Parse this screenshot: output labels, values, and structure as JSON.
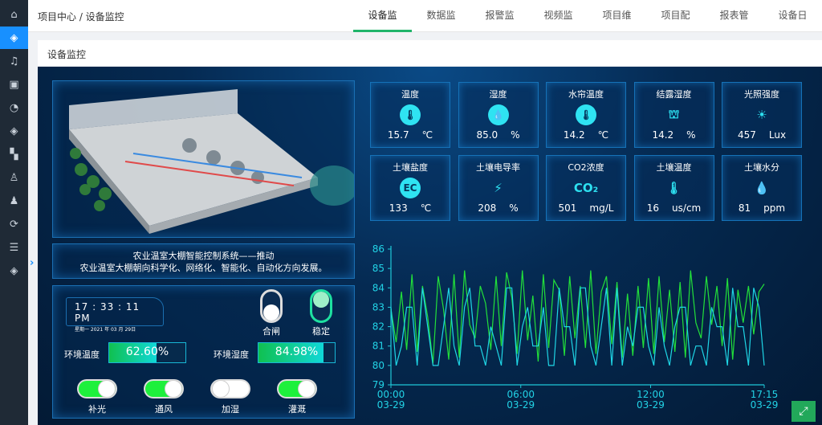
{
  "sidebar": {
    "items": [
      "home-icon",
      "layers-icon",
      "bell-icon",
      "cube-icon",
      "dashboard-icon",
      "layers-icon",
      "puzzle-icon",
      "user-icon",
      "group-icon",
      "refresh-icon",
      "list-icon",
      "layers-icon"
    ],
    "active": 1
  },
  "breadcrumb": "项目中心 / 设备监控",
  "tabs": [
    {
      "label": "设备监控",
      "active": true
    },
    {
      "label": "数据监控"
    },
    {
      "label": "报警监控"
    },
    {
      "label": "视频监控"
    },
    {
      "label": "项目维保"
    },
    {
      "label": "项目配置"
    },
    {
      "label": "报表管理"
    },
    {
      "label": "设备日志"
    }
  ],
  "panel_title": "设备监控",
  "slogan": {
    "line1": "农业温室大棚智能控制系统——推动",
    "line2": "农业温室大棚朝向科学化、网络化、智能化、自动化方向发展。"
  },
  "sensors": [
    {
      "label": "温度",
      "value": "15.7",
      "unit": "℃",
      "icon": "thermometer-icon",
      "glyph": "🌡"
    },
    {
      "label": "湿度",
      "value": "85.0",
      "unit": "%",
      "icon": "droplet-icon",
      "glyph": "💧"
    },
    {
      "label": "水帘温度",
      "value": "14.2",
      "unit": "℃",
      "icon": "thermometer-icon",
      "glyph": "🌡"
    },
    {
      "label": "结露湿度",
      "value": "14.2",
      "unit": "%",
      "icon": "dew-icon",
      "glyph": "⛫"
    },
    {
      "label": "光照强度",
      "value": "457",
      "unit": "Lux",
      "icon": "sun-icon",
      "glyph": "☀"
    },
    {
      "label": "土壤盐度",
      "value": "133",
      "unit": "℃",
      "icon": "ec-icon",
      "glyph": "EC"
    },
    {
      "label": "土壤电导率",
      "value": "208",
      "unit": "%",
      "icon": "conductivity-icon",
      "glyph": "⚡"
    },
    {
      "label": "CO2浓度",
      "value": "501",
      "unit": "mg/L",
      "icon": "co2-icon",
      "glyph": "CO₂"
    },
    {
      "label": "土壤温度",
      "value": "16",
      "unit": "us/cm",
      "icon": "soil-temp-icon",
      "glyph": "🌡"
    },
    {
      "label": "土壤水分",
      "value": "81",
      "unit": "ppm",
      "icon": "water-drops-icon",
      "glyph": "💧"
    }
  ],
  "clock": {
    "time": "17 : 33 : 11  PM",
    "date": "星期一    2021 年 03 月 29日"
  },
  "status": [
    {
      "label": "合闸",
      "state": "off"
    },
    {
      "label": "稳定",
      "state": "on"
    }
  ],
  "env": [
    {
      "label": "环境温度",
      "value": "62.60%",
      "percent": 62.6
    },
    {
      "label": "环境湿度",
      "value": "84.98%",
      "percent": 84.98
    }
  ],
  "toggles": [
    {
      "label": "补光",
      "on": true
    },
    {
      "label": "通风",
      "on": true
    },
    {
      "label": "加湿",
      "on": false
    },
    {
      "label": "灌溉",
      "on": true
    }
  ],
  "chart_data": {
    "type": "line",
    "ylim": [
      79,
      86
    ],
    "yticks": [
      "79",
      "80",
      "81",
      "82",
      "83",
      "84",
      "85",
      "86"
    ],
    "xticks": [
      {
        "time": "00:00",
        "date": "03-29",
        "min": 0
      },
      {
        "time": "06:00",
        "date": "03-29",
        "min": 360
      },
      {
        "time": "12:00",
        "date": "03-29",
        "min": 720
      },
      {
        "time": "17:15",
        "date": "03-29",
        "min": 1035
      }
    ],
    "x_range_minutes": [
      0,
      1035
    ],
    "series": [
      {
        "name": "series-green",
        "color": "#22e03a",
        "values": [
          82.9,
          81.2,
          83.8,
          80.8,
          84.7,
          80.7,
          84.1,
          82.5,
          80.1,
          84.6,
          82.9,
          80.3,
          84.7,
          80.4,
          84.9,
          82.1,
          81.4,
          84.1,
          83.2,
          80.8,
          84.6,
          81.0,
          84.8,
          83.5,
          80.6,
          84.9,
          81.3,
          83.6,
          80.2,
          84.7,
          80.9,
          84.4,
          83.9,
          80.5,
          84.6,
          81.4,
          84.1,
          80.9,
          84.9,
          80.6,
          83.8,
          84.6,
          81.1,
          84.3,
          80.4,
          83.7,
          80.5,
          84.1,
          80.9,
          84.5,
          80.6,
          84.6,
          81.2,
          83.9,
          80.7,
          84.3,
          80.4,
          84.9,
          82.2,
          81.4,
          84.6,
          82.1,
          84.1,
          81.0,
          84.5,
          80.3,
          83.9,
          82.2,
          84.1,
          81.6,
          83.8,
          84.2
        ]
      },
      {
        "name": "series-cyan",
        "color": "#1fd6e6",
        "values": [
          83,
          80,
          81,
          83,
          83,
          80,
          84,
          82,
          80,
          80,
          82,
          84,
          81,
          80,
          83,
          84,
          81,
          81,
          80,
          82,
          81,
          80,
          84,
          84,
          80,
          82,
          83,
          81,
          81,
          83,
          80,
          80,
          84,
          82,
          82,
          80,
          84,
          84,
          81,
          80,
          82,
          84,
          80,
          84,
          80,
          82,
          81,
          83,
          83,
          81,
          80,
          83,
          81,
          80,
          82,
          83,
          83,
          80,
          81,
          81,
          80,
          83,
          82,
          82,
          80,
          84,
          82,
          82,
          80,
          84,
          83,
          80
        ]
      }
    ]
  },
  "expand_icon": "⤢"
}
